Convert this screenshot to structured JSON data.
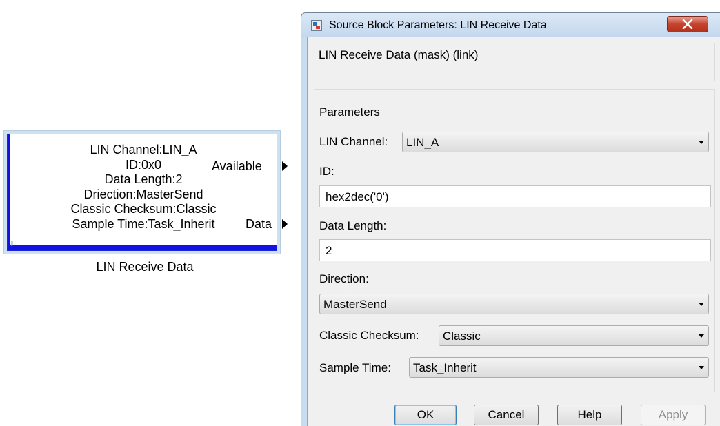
{
  "block": {
    "lines": [
      "LIN Channel:LIN_A",
      "ID:0x0",
      "Data Length:2",
      "Driection:MasterSend",
      "Classic Checksum:Classic",
      "Sample Time:Task_Inherit"
    ],
    "ports": [
      "Available",
      "Data"
    ],
    "caption": "LIN Receive Data"
  },
  "dialog": {
    "title": "Source Block Parameters: LIN Receive Data",
    "description_title": "LIN Receive Data (mask) (link)",
    "parameters_legend": "Parameters",
    "lin_channel": {
      "label": "LIN Channel:",
      "value": "LIN_A"
    },
    "id": {
      "label": "ID:",
      "value": "hex2dec('0')"
    },
    "data_length": {
      "label": "Data Length:",
      "value": "2"
    },
    "direction": {
      "label": "Direction:",
      "value": "MasterSend"
    },
    "classic_checksum": {
      "label": "Classic Checksum:",
      "value": "Classic"
    },
    "sample_time": {
      "label": "Sample Time:",
      "value": "Task_Inherit"
    },
    "buttons": {
      "ok": "OK",
      "cancel": "Cancel",
      "help": "Help",
      "apply": "Apply"
    }
  },
  "icons": [
    "block-resize-icon",
    "output-port-arrow-icon",
    "simulink-app-icon",
    "close-x-icon",
    "dropdown-caret-icon"
  ],
  "colors": {
    "block_border": "#1212e6",
    "selection_halo": "#cfe1f1",
    "close_button": "#c7432d",
    "dialog_frame": "#c9dcef"
  }
}
